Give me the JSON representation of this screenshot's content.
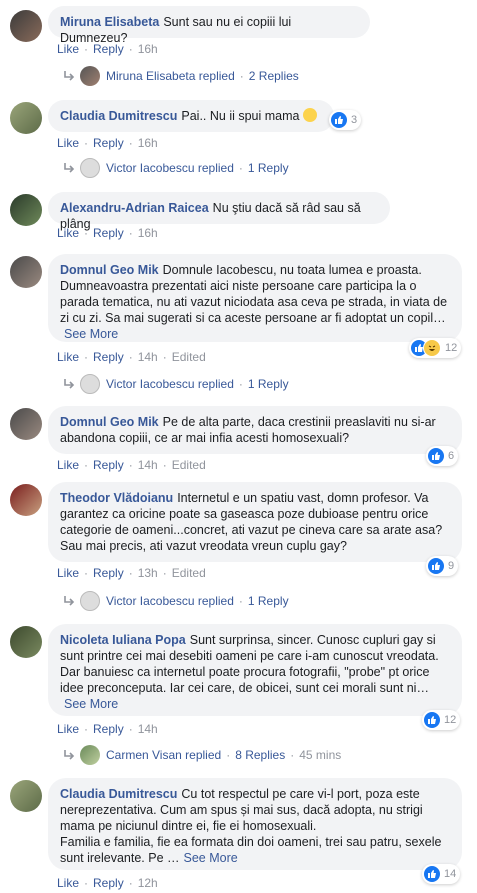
{
  "actions": {
    "like": "Like",
    "reply": "Reply",
    "edited": "Edited",
    "see_more": "See More"
  },
  "comments": [
    {
      "author": "Miruna Elisabeta",
      "text": "Sunt sau nu ei copiii lui Dumnezeu?",
      "time": "16h"
    },
    {
      "author": "Claudia Dumitrescu",
      "text": "Pai.. Nu ii spui mama",
      "time": "16h",
      "reactions": "3"
    },
    {
      "author": "Alexandru-Adrian Raicea",
      "text": "Nu ştiu dacă să râd sau să plâng",
      "time": "16h"
    },
    {
      "author": "Domnul Geo Mik",
      "text": "Domnule Iacobescu, nu toata lumea e proasta. Dumneavoastra prezentati aici niste persoane care participa la o parada tematica, nu ati vazut niciodata asa ceva pe strada, in viata de zi cu zi. Sa mai sugerati si ca aceste persoane ar fi adoptat un copil…",
      "time": "14h",
      "reactions": "12"
    },
    {
      "author": "Domnul Geo Mik",
      "text": "Pe de alta parte, daca crestinii preaslaviti nu si-ar abandona copiii, ce ar mai infia acesti homosexuali?",
      "time": "14h",
      "reactions": "6"
    },
    {
      "author": "Theodor Vlădoianu",
      "text": "Internetul e un spatiu vast, domn profesor. Va garantez ca oricine poate sa gaseasca poze dubioase pentru orice categorie de oameni...concret, ati vazut pe cineva care sa arate asa? Sau mai precis, ati vazut vreodata vreun cuplu gay?",
      "time": "13h",
      "reactions": "9"
    },
    {
      "author": "Nicoleta Iuliana Popa",
      "text": "Sunt surprinsa, sincer. Cunosc cupluri gay si sunt printre cei mai desebiti oameni pe care i-am cunoscut vreodata. Dar banuiesc ca internetul poate procura fotografii, \"probe\" pt orice idee preconceputa. Iar cei care, de obicei, sunt cei morali sunt ni…",
      "time": "14h",
      "reactions": "12"
    },
    {
      "author": "Claudia Dumitrescu",
      "text_lines": [
        "Cu tot respectul pe care vi-l port, poza este nereprezentativa. Cum am spus și mai sus, dacă adopta, nu strigi mama pe niciunul dintre ei, fie ei homosexuali.",
        "Familia e familia, fie ea formata din doi oameni, trei sau patru, sexele sunt irelevante. Pe …"
      ],
      "time": "12h",
      "reactions": "14"
    }
  ],
  "replies": [
    {
      "name": "Miruna Elisabeta",
      "suffix": "replied",
      "count": "2 Replies"
    },
    {
      "name": "Victor Iacobescu",
      "suffix": "replied",
      "count": "1 Reply"
    },
    {
      "name": "Victor Iacobescu",
      "suffix": "replied",
      "count": "1 Reply"
    },
    {
      "name": "Victor Iacobescu",
      "suffix": "replied",
      "count": "1 Reply"
    },
    {
      "name": "Carmen Visan",
      "suffix": "replied",
      "count": "8 Replies",
      "time": "45 mins"
    }
  ],
  "colors": {
    "link": "#385898",
    "bubble": "#f2f3f5",
    "muted": "#90949c",
    "like": "#1877f2"
  },
  "icons": [
    "reply-arrow-icon",
    "like-reaction-icon",
    "haha-reaction-icon",
    "smiley-emoji-icon"
  ]
}
